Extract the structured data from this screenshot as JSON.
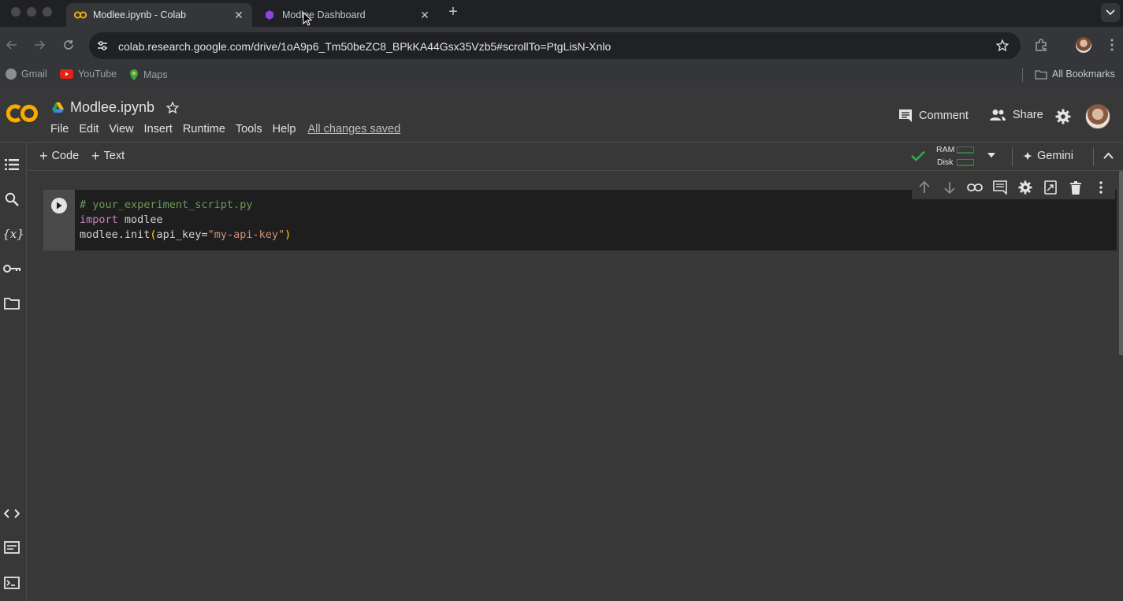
{
  "browser": {
    "tabs": [
      {
        "title": "Modlee.ipynb - Colab",
        "active": true,
        "favicon": "colab-icon"
      },
      {
        "title": "Modlee Dashboard",
        "active": false,
        "favicon": "modlee-icon"
      }
    ],
    "url": "colab.research.google.com/drive/1oA9p6_Tm50beZC8_BPkKA44Gsx35Vzb5#scrollTo=PtgLisN-Xnlo",
    "bookmarks": [
      {
        "label": "Gmail",
        "icon": "globe-icon"
      },
      {
        "label": "YouTube",
        "icon": "youtube-icon"
      },
      {
        "label": "Maps",
        "icon": "maps-icon"
      }
    ],
    "all_bookmarks": "All Bookmarks"
  },
  "colab": {
    "logo_text": "CO",
    "notebook_title": "Modlee.ipynb",
    "menu": [
      "File",
      "Edit",
      "View",
      "Insert",
      "Runtime",
      "Tools",
      "Help"
    ],
    "save_status": "All changes saved",
    "comment_label": "Comment",
    "share_label": "Share",
    "add_code": "Code",
    "add_text": "Text",
    "ram_label": "RAM",
    "disk_label": "Disk",
    "gemini_label": "Gemini",
    "accent": "#f9ab00",
    "connected_color": "#34a853"
  },
  "cell": {
    "line1": "# your_experiment_script.py",
    "line2_kw": "import",
    "line2_rest": " modlee",
    "line3_pre": "modlee.init",
    "line3_open": "(",
    "line3_arg": "api_key=",
    "line3_str": "\"my-api-key\"",
    "line3_close": ")"
  }
}
